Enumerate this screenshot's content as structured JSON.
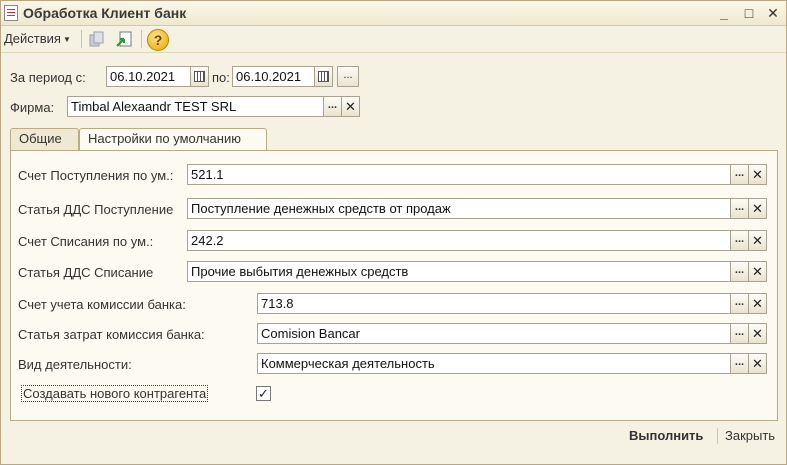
{
  "window": {
    "title": "Обработка  Клиент банк"
  },
  "titlebar_buttons": {
    "minimize": "_",
    "maximize": "□",
    "close": "✕"
  },
  "toolbar": {
    "actions_label": "Действия",
    "help": "?"
  },
  "period": {
    "label": "За период с:",
    "from": "06.10.2021",
    "to_label": "по:",
    "to": "06.10.2021",
    "more": "..."
  },
  "firm": {
    "label": "Фирма:",
    "value": "Timbal Alexaandr TEST SRL",
    "select": "...",
    "clear": "✕"
  },
  "tabs": [
    {
      "label": "Общие"
    },
    {
      "label": "Настройки по умолчанию"
    }
  ],
  "rows": [
    {
      "label": "Счет Поступления по ум.:",
      "value": "521.1"
    },
    {
      "label": "Статья ДДС Поступление",
      "value": "Поступление денежных средств от продаж"
    },
    {
      "label": "Счет Списания по ум.:",
      "value": "242.2"
    },
    {
      "label": "Статья ДДС Списание",
      "value": "Прочие выбытия денежных средств"
    },
    {
      "label": "Счет учета комиссии банка:",
      "value": "713.8"
    },
    {
      "label": "Статья затрат комиссия банка:",
      "value": "Comision Bancar"
    },
    {
      "label": "Вид деятельности:",
      "value": "Коммерческая деятельность"
    }
  ],
  "field_buttons": {
    "select": "...",
    "clear": "✕"
  },
  "create_counterparty": {
    "label": "Создавать нового контрагента",
    "checked": true,
    "mark": "✓"
  },
  "footer": {
    "run": "Выполнить",
    "close": "Закрыть"
  }
}
